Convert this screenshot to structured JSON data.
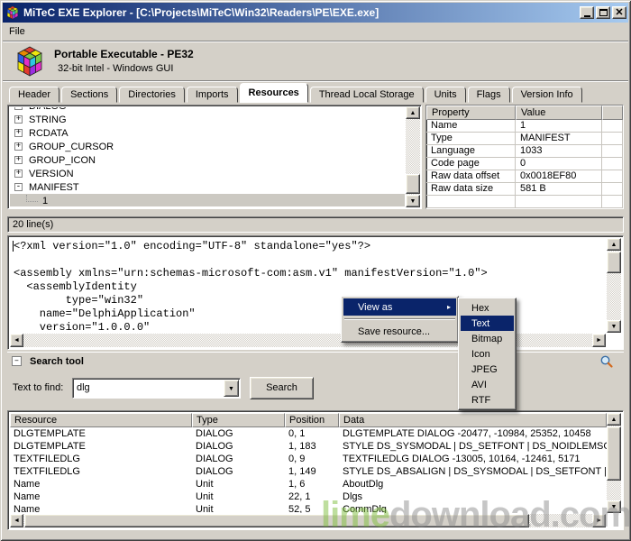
{
  "colors": {
    "titlebar_gradient_start": "#0a246a",
    "titlebar_gradient_end": "#a6caf0",
    "selection": "#0a246a",
    "window_chrome": "#d4d0c8",
    "watermark_prefix": "#7fbf3f",
    "watermark_suffix": "#8f8f8f"
  },
  "window": {
    "title": "MiTeC EXE Explorer - [C:\\Projects\\MiTeC\\Win32\\Readers\\PE\\EXE.exe]",
    "menu": [
      "File"
    ]
  },
  "file_header": {
    "title": "Portable Executable - PE32",
    "subtitle": "32-bit Intel - Windows GUI"
  },
  "tabs": {
    "items": [
      "Header",
      "Sections",
      "Directories",
      "Imports",
      "Resources",
      "Thread Local Storage",
      "Units",
      "Flags",
      "Version Info"
    ],
    "active": "Resources"
  },
  "resource_tree": {
    "items": [
      {
        "label": "DIALOG",
        "expander": "+"
      },
      {
        "label": "STRING",
        "expander": "+"
      },
      {
        "label": "RCDATA",
        "expander": "+"
      },
      {
        "label": "GROUP_CURSOR",
        "expander": "+"
      },
      {
        "label": "GROUP_ICON",
        "expander": "+"
      },
      {
        "label": "VERSION",
        "expander": "+"
      },
      {
        "label": "MANIFEST",
        "expander": "-"
      },
      {
        "label": "1",
        "child": true,
        "selected": true
      }
    ]
  },
  "properties": {
    "columns": [
      "Property",
      "Value"
    ],
    "rows": [
      {
        "property": "Name",
        "value": "1"
      },
      {
        "property": "Type",
        "value": "MANIFEST"
      },
      {
        "property": "Language",
        "value": "1033"
      },
      {
        "property": "Code page",
        "value": "0"
      },
      {
        "property": "Raw data offset",
        "value": "0x0018EF80"
      },
      {
        "property": "Raw data size",
        "value": "581 B"
      }
    ]
  },
  "viewer": {
    "status": "20 line(s)",
    "lines": [
      "<?xml version=\"1.0\" encoding=\"UTF-8\" standalone=\"yes\"?>",
      "",
      "<assembly xmlns=\"urn:schemas-microsoft-com:asm.v1\" manifestVersion=\"1.0\">",
      "  <assemblyIdentity",
      "        type=\"win32\"",
      "    name=\"DelphiApplication\"",
      "    version=\"1.0.0.0\""
    ]
  },
  "context_menu": {
    "items": [
      {
        "label": "View as",
        "has_submenu": true,
        "highlighted": true
      },
      {
        "separator": true
      },
      {
        "label": "Save resource..."
      }
    ],
    "submenu": {
      "items": [
        "Hex",
        "Text",
        "Bitmap",
        "Icon",
        "JPEG",
        "AVI",
        "RTF"
      ],
      "highlighted": "Text"
    }
  },
  "search_tool": {
    "title": "Search tool",
    "find_label": "Text to find:",
    "query": "dlg",
    "search_button": "Search"
  },
  "results": {
    "columns": [
      "Resource",
      "Type",
      "Position",
      "Data"
    ],
    "rows": [
      {
        "resource": "DLGTEMPLATE",
        "type": "DIALOG",
        "position": "0, 1",
        "data": "DLGTEMPLATE DIALOG -20477, -10984, 25352, 10458"
      },
      {
        "resource": "DLGTEMPLATE",
        "type": "DIALOG",
        "position": "1, 183",
        "data": "STYLE DS_SYSMODAL | DS_SETFONT | DS_NOIDLEMSG | DS_S"
      },
      {
        "resource": "TEXTFILEDLG",
        "type": "DIALOG",
        "position": "0, 9",
        "data": "TEXTFILEDLG DIALOG -13005, 10164, -12461, 5171"
      },
      {
        "resource": "TEXTFILEDLG",
        "type": "DIALOG",
        "position": "1, 149",
        "data": "STYLE DS_ABSALIGN | DS_SYSMODAL | DS_SETFONT | DS_MO"
      },
      {
        "resource": "Name",
        "type": "Unit",
        "position": "1, 6",
        "data": "AboutDlg"
      },
      {
        "resource": "Name",
        "type": "Unit",
        "position": "22, 1",
        "data": "Dlgs"
      },
      {
        "resource": "Name",
        "type": "Unit",
        "position": "52, 5",
        "data": "CommDlg"
      }
    ]
  },
  "watermark": {
    "prefix": "lime",
    "suffix": "download.com"
  }
}
